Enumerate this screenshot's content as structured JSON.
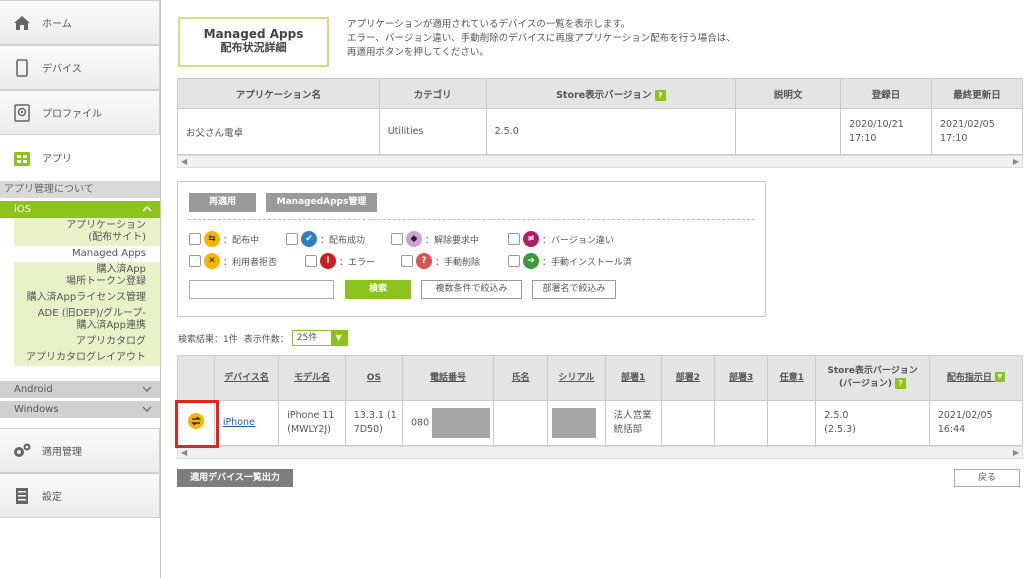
{
  "sidebar": {
    "home": "ホーム",
    "devices": "デバイス",
    "profiles": "プロファイル",
    "apps": "アプリ",
    "about_app_mgmt": "アプリ管理について",
    "ios": {
      "label": "iOS",
      "items": [
        {
          "label": "アプリケーション\n(配布サイト)"
        },
        {
          "label": "Managed Apps"
        },
        {
          "label": "購入済App\n場所トークン登録"
        },
        {
          "label": "購入済Appライセンス管理"
        },
        {
          "label": "ADE (旧DEP)/グループ-\n購入済App連携"
        },
        {
          "label": "アプリカタログ"
        },
        {
          "label": "アプリカタログレイアウト"
        }
      ]
    },
    "android": "Android",
    "windows": "Windows",
    "apply_mgmt": "適用管理",
    "settings": "設定"
  },
  "page": {
    "title_line1": "Managed Apps",
    "title_line2": "配布状況詳細",
    "desc_line1": "アプリケーションが適用されているデバイスの一覧を表示します。",
    "desc_line2": "エラー、バージョン違い、手動削除のデバイスに再度アプリケーション配布を行う場合は、",
    "desc_line3": "再適用ボタンを押してください。"
  },
  "app_table": {
    "headers": [
      "アプリケーション名",
      "カテゴリ",
      "Store表示バージョン",
      "説明文",
      "登録日",
      "最終更新日"
    ],
    "help": "?",
    "row": {
      "name": "お父さん電卓",
      "category": "Utilities",
      "version": "2.5.0",
      "description": "",
      "registered": "2020/10/21\n17:10",
      "updated": "2021/02/05\n17:10"
    }
  },
  "filter": {
    "reapply": "再適用",
    "managed_apps_mgmt": "ManagedApps管理",
    "statuses": [
      {
        "label": "：配布中",
        "icon": "distributing-icon",
        "color": "#f5b400"
      },
      {
        "label": "：配布成功",
        "icon": "success-icon",
        "color": "#2f7fbf"
      },
      {
        "label": "：解除要求中",
        "icon": "release-request-icon",
        "color": "#c9a0d8"
      },
      {
        "label": "：バージョン違い",
        "icon": "version-diff-icon",
        "color": "#b01e6a"
      },
      {
        "label": "：利用者拒否",
        "icon": "user-refused-icon",
        "color": "#f5b400"
      },
      {
        "label": "：エラー",
        "icon": "error-icon",
        "color": "#cc1f1f"
      },
      {
        "label": "：手動削除",
        "icon": "manual-delete-icon",
        "color": "#d9534f"
      },
      {
        "label": "：手動インストール済",
        "icon": "manual-install-icon",
        "color": "#3a9a3a"
      }
    ],
    "search_placeholder": "",
    "search": "検索",
    "multi_filter": "複数条件で絞込み",
    "dept_filter": "部署名で絞込み"
  },
  "results": {
    "count_label": "検索結果：1件",
    "per_page_label": "表示件数：",
    "per_page_value": "25件"
  },
  "device_table": {
    "headers": [
      "デバイス名",
      "モデル名",
      "OS",
      "電話番号",
      "氏名",
      "シリアル",
      "部署1",
      "部署2",
      "部署3",
      "任意1",
      "Store表示バージョン\n(バージョン)",
      "配布指示日"
    ],
    "row": {
      "device": "iPhone",
      "model": "iPhone 11\n(MWLY2J)",
      "os": "13.3.1 (1\n7D50)",
      "phone": "080",
      "name": "",
      "dept1": "法人営業\n統括部",
      "store_version": "2.5.0\n(2.5.3)",
      "date": "2021/02/05\n16:44"
    }
  },
  "footer": {
    "export": "適用デバイス一覧出力",
    "back": "戻る"
  }
}
